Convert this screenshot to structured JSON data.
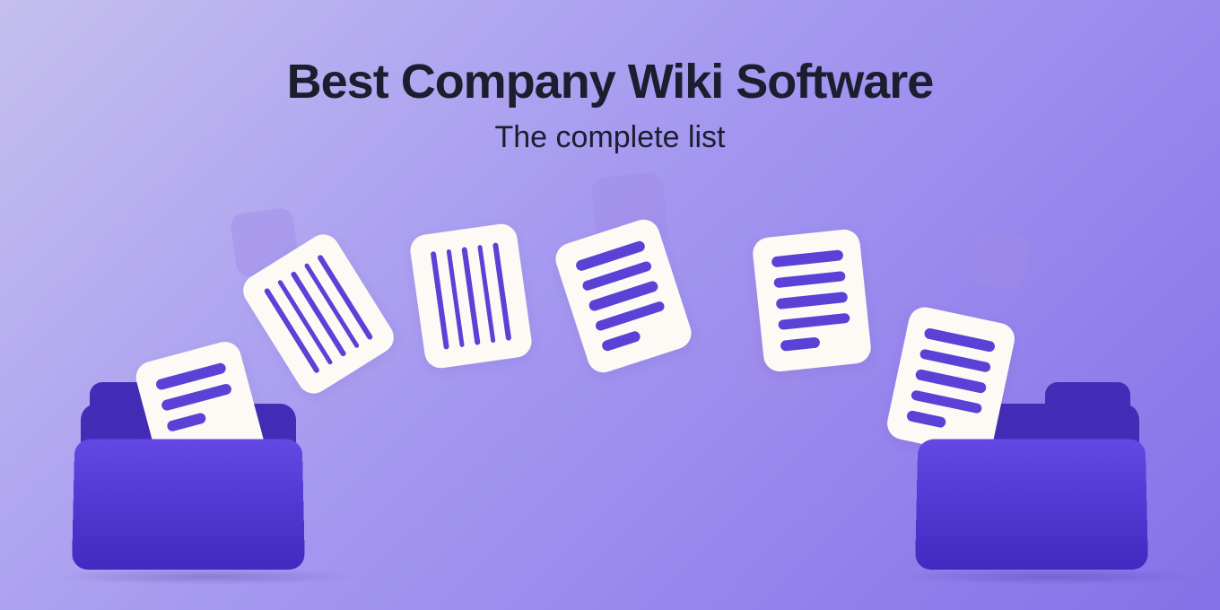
{
  "headline": {
    "title": "Best Company Wiki Software",
    "subtitle": "The complete list"
  }
}
